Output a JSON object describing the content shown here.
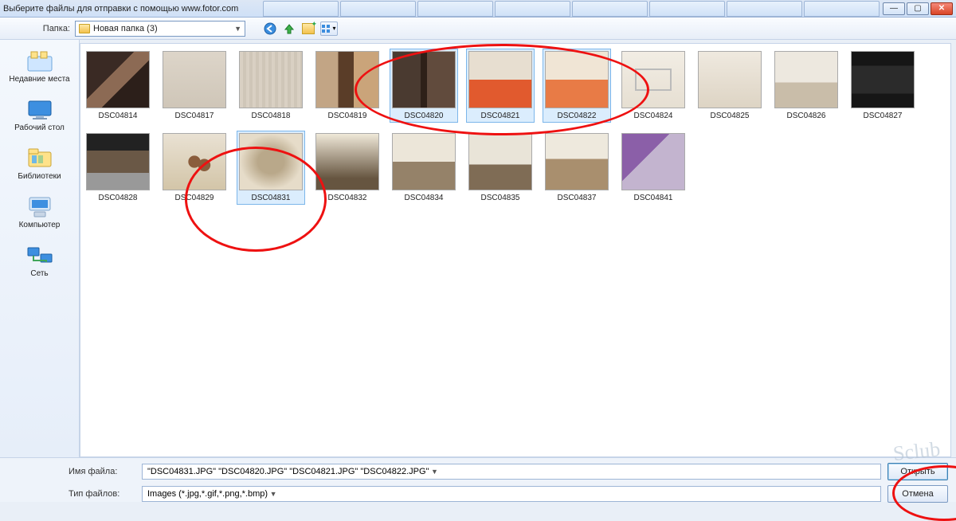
{
  "window": {
    "title": "Выберите файлы для отправки с помощью www.fotor.com"
  },
  "bg_tabs": [
    "",
    "",
    "",
    "",
    "",
    "",
    "",
    ""
  ],
  "toolbar": {
    "folder_label": "Папка:",
    "folder_value": "Новая папка (3)"
  },
  "sidebar": [
    {
      "label": "Недавние места"
    },
    {
      "label": "Рабочий стол"
    },
    {
      "label": "Библиотеки"
    },
    {
      "label": "Компьютер"
    },
    {
      "label": "Сеть"
    }
  ],
  "files_row1": [
    {
      "name": "DSC04814",
      "imgClass": "i1",
      "selected": false
    },
    {
      "name": "DSC04817",
      "imgClass": "i2",
      "selected": false
    },
    {
      "name": "DSC04818",
      "imgClass": "i3",
      "selected": false
    },
    {
      "name": "DSC04819",
      "imgClass": "i4",
      "selected": false
    },
    {
      "name": "DSC04820",
      "imgClass": "i5",
      "selected": true
    },
    {
      "name": "DSC04821",
      "imgClass": "i6",
      "selected": true
    },
    {
      "name": "DSC04822",
      "imgClass": "i7",
      "selected": true
    },
    {
      "name": "DSC04824",
      "imgClass": "i8",
      "selected": false
    },
    {
      "name": "DSC04825",
      "imgClass": "i9",
      "selected": false
    },
    {
      "name": "DSC04826",
      "imgClass": "i10",
      "selected": false
    },
    {
      "name": "DSC04827",
      "imgClass": "i11",
      "selected": false
    }
  ],
  "files_row2": [
    {
      "name": "DSC04828",
      "imgClass": "i12",
      "selected": false
    },
    {
      "name": "DSC04829",
      "imgClass": "i13",
      "selected": false
    },
    {
      "name": "DSC04831",
      "imgClass": "i14",
      "selected": true
    },
    {
      "name": "DSC04832",
      "imgClass": "i15",
      "selected": false
    },
    {
      "name": "DSC04834",
      "imgClass": "i16",
      "selected": false
    },
    {
      "name": "DSC04835",
      "imgClass": "i17",
      "selected": false
    },
    {
      "name": "DSC04837",
      "imgClass": "i18",
      "selected": false
    },
    {
      "name": "DSC04841",
      "imgClass": "i19",
      "selected": false
    }
  ],
  "bottom": {
    "filename_label": "Имя файла:",
    "filename_value": "\"DSC04831.JPG\" \"DSC04820.JPG\" \"DSC04821.JPG\" \"DSC04822.JPG\"",
    "filetype_label": "Тип файлов:",
    "filetype_value": "Images (*.jpg,*.gif,*.png,*.bmp)",
    "open_label": "Открыть",
    "cancel_label": "Отмена"
  },
  "watermark": "Sclub"
}
